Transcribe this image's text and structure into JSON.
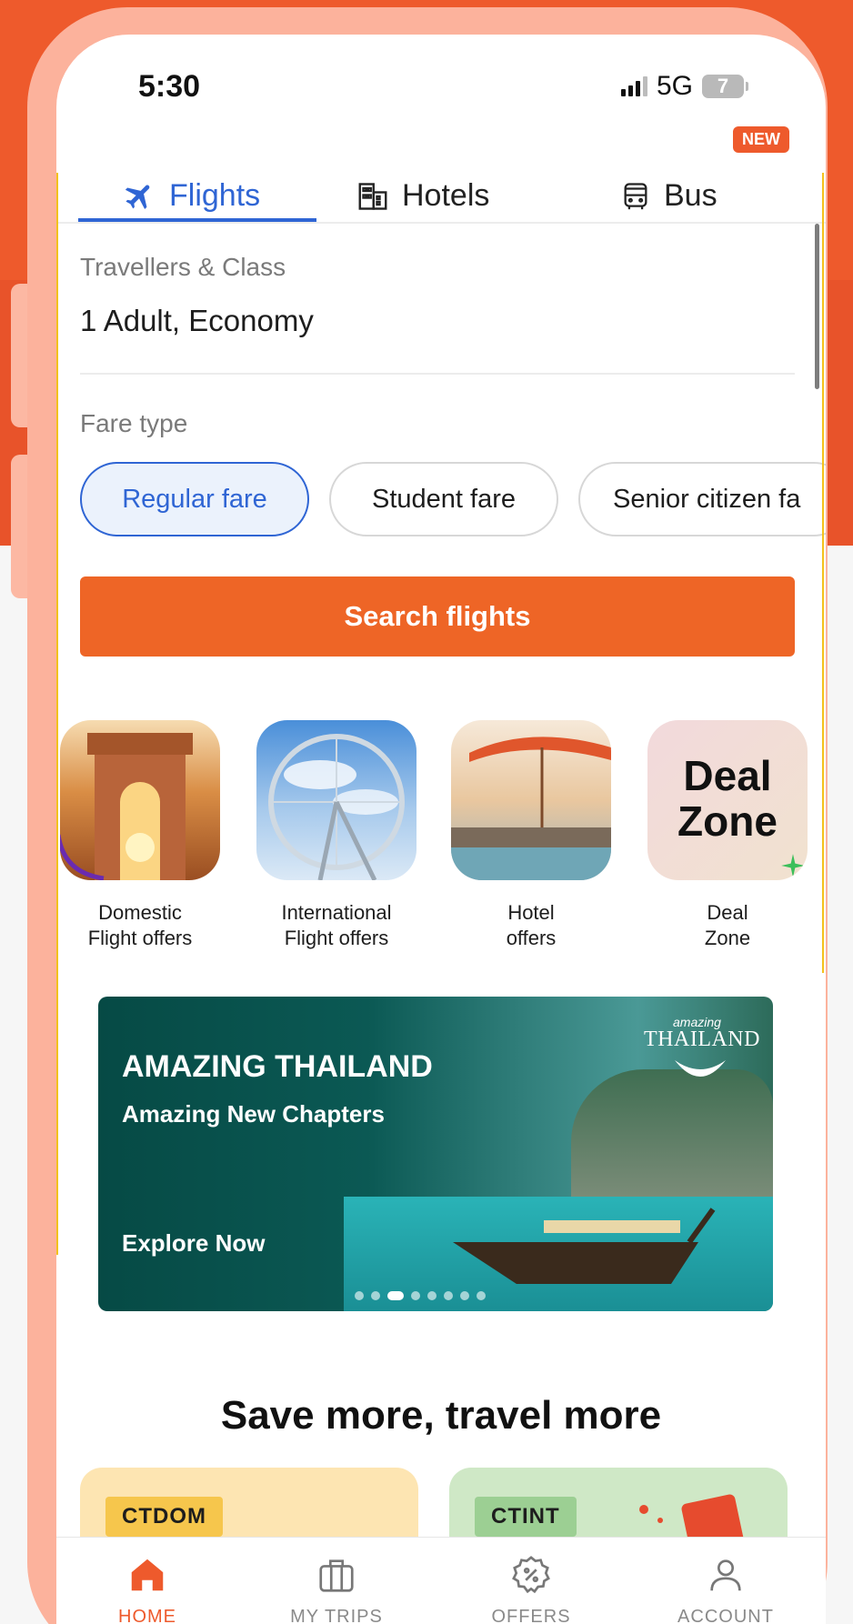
{
  "status_bar": {
    "time": "5:30",
    "network": "5G",
    "battery": "7"
  },
  "tabs": [
    {
      "label": "Flights",
      "icon": "airplane-icon"
    },
    {
      "label": "Hotels",
      "icon": "building-icon"
    },
    {
      "label": "Bus",
      "icon": "bus-icon",
      "badge": "NEW"
    }
  ],
  "form": {
    "travellers_label": "Travellers & Class",
    "travellers_value": "1 Adult, Economy",
    "fare_type_label": "Fare type",
    "fare_options": [
      "Regular fare",
      "Student fare",
      "Senior citizen fa"
    ],
    "selected_fare": "Regular fare",
    "search_button": "Search flights"
  },
  "offers": [
    {
      "line1": "Domestic",
      "line2": "Flight offers"
    },
    {
      "line1": "International",
      "line2": "Flight offers"
    },
    {
      "line1": "Hotel",
      "line2": "offers"
    },
    {
      "line1": "Deal",
      "line2": "Zone",
      "image_text_1": "Deal",
      "image_text_2": "Zone"
    }
  ],
  "banner": {
    "title": "AMAZING THAILAND",
    "subtitle": "Amazing New Chapters",
    "cta": "Explore Now",
    "brand_small": "amazing",
    "brand": "THAILAND"
  },
  "promo": {
    "title": "Save more, travel more",
    "coupons": [
      "CTDOM",
      "CTINT"
    ]
  },
  "bottom_nav": [
    {
      "label": "HOME",
      "icon": "home-icon",
      "active": true
    },
    {
      "label": "MY TRIPS",
      "icon": "suitcase-icon"
    },
    {
      "label": "OFFERS",
      "icon": "discount-icon"
    },
    {
      "label": "ACCOUNT",
      "icon": "user-icon"
    }
  ],
  "colors": {
    "accent": "#ee5a2c",
    "primary_blue": "#2f65d4",
    "frame": "#fcb29c"
  }
}
